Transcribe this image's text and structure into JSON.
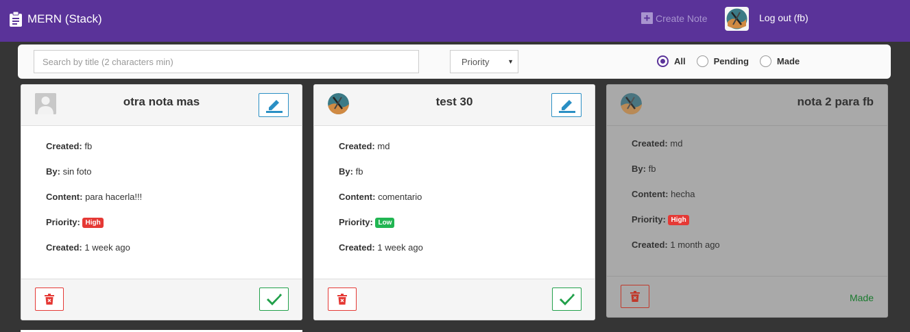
{
  "navbar": {
    "brand": "MERN (Stack)",
    "create_note": "Create Note",
    "logout": "Log out (fb)",
    "brand_icon": "clipboard-icon",
    "create_icon": "plus-square-icon"
  },
  "filters": {
    "search_placeholder": "Search by title (2 characters min)",
    "priority_label": "Priority",
    "status_options": [
      "All",
      "Pending",
      "Made"
    ],
    "status_selected": "All"
  },
  "labels": {
    "created": "Created:",
    "by": "By:",
    "content": "Content:",
    "priority": "Priority:"
  },
  "notes": [
    {
      "title": "otra nota mas",
      "created": "fb",
      "by": "sin foto",
      "content": "para hacerla!!!",
      "priority": "High",
      "created_ago": "1 week ago",
      "status": "pending"
    },
    {
      "title": "test 30",
      "created": "md",
      "by": "fb",
      "content": "comentario",
      "priority": "Low",
      "created_ago": "1 week ago",
      "status": "pending"
    },
    {
      "title": "nota 2 para fb",
      "created": "md",
      "by": "fb",
      "content": "hecha",
      "priority": "High",
      "created_ago": "1 month ago",
      "status": "Made"
    }
  ],
  "colors": {
    "navbar": "#5a3399",
    "background": "#353535",
    "high": "#e53935",
    "low": "#21b552",
    "edit": "#2a8fc4",
    "done": "#21a04a"
  }
}
